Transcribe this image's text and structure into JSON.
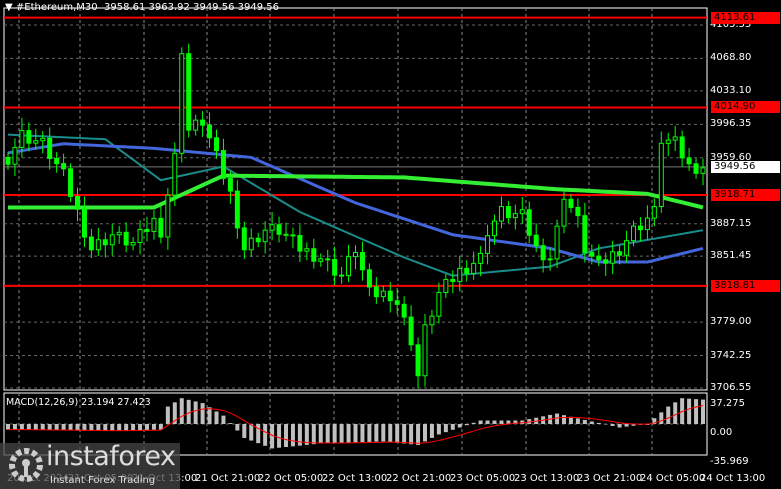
{
  "header": {
    "symbol": "#Ethereum,M30",
    "open": "3958.61",
    "high": "3963.92",
    "low": "3949.56",
    "close": "3949.56"
  },
  "price_axis": [
    "4105.55",
    "4068.80",
    "4033.10",
    "3996.35",
    "3959.60",
    "3887.15",
    "3851.45",
    "3779.00",
    "3742.25",
    "3706.55"
  ],
  "levels": [
    {
      "label": "4113.61",
      "value": 4113.61
    },
    {
      "label": "4014.90",
      "value": 4014.9
    },
    {
      "label": "3918.71",
      "value": 3918.71
    },
    {
      "label": "3818.81",
      "value": 3818.81
    }
  ],
  "current_price": {
    "label": "3949.56",
    "value": 3949.56
  },
  "macd": {
    "title": "MACD(12,26,9) 23.194 27.423",
    "axis": [
      "37.275",
      "0.00",
      "-35.969"
    ],
    "hist_keypoints": [
      [
        0,
        -8
      ],
      [
        14,
        -10
      ],
      [
        22,
        -8
      ],
      [
        23,
        25
      ],
      [
        25,
        37
      ],
      [
        28,
        30
      ],
      [
        31,
        12
      ],
      [
        34,
        -20
      ],
      [
        38,
        -35
      ],
      [
        45,
        -28
      ],
      [
        54,
        -25
      ],
      [
        59,
        -30
      ],
      [
        62,
        -15
      ],
      [
        68,
        5
      ],
      [
        74,
        5
      ],
      [
        79,
        15
      ],
      [
        82,
        8
      ],
      [
        88,
        -5
      ],
      [
        92,
        0
      ],
      [
        95,
        25
      ],
      [
        97,
        37
      ],
      [
        100,
        35
      ]
    ]
  },
  "time_axis": [
    "20 Oct 2024",
    "21 Oct 05:00",
    "21 Oct 13:00",
    "21 Oct 21:00",
    "22 Oct 05:00",
    "22 Oct 13:00",
    "22 Oct 21:00",
    "23 Oct 05:00",
    "23 Oct 13:00",
    "23 Oct 21:00",
    "24 Oct 05:00",
    "24 Oct 13:00"
  ],
  "chart_data": {
    "type": "candlestick",
    "ylim": [
      3706.55,
      4113.61
    ],
    "close_keypoints": [
      [
        0,
        3960
      ],
      [
        2,
        3985
      ],
      [
        5,
        3975
      ],
      [
        8,
        3940
      ],
      [
        11,
        3880
      ],
      [
        12,
        3860
      ],
      [
        15,
        3875
      ],
      [
        18,
        3865
      ],
      [
        21,
        3890
      ],
      [
        22,
        3880
      ],
      [
        24,
        3960
      ],
      [
        25,
        4080
      ],
      [
        26,
        3990
      ],
      [
        28,
        4000
      ],
      [
        30,
        3960
      ],
      [
        32,
        3920
      ],
      [
        34,
        3860
      ],
      [
        37,
        3880
      ],
      [
        39,
        3880
      ],
      [
        42,
        3860
      ],
      [
        45,
        3850
      ],
      [
        48,
        3830
      ],
      [
        50,
        3860
      ],
      [
        52,
        3810
      ],
      [
        55,
        3810
      ],
      [
        56,
        3800
      ],
      [
        58,
        3760
      ],
      [
        59,
        3720
      ],
      [
        60,
        3770
      ],
      [
        62,
        3810
      ],
      [
        65,
        3835
      ],
      [
        68,
        3850
      ],
      [
        69,
        3880
      ],
      [
        71,
        3900
      ],
      [
        74,
        3895
      ],
      [
        76,
        3860
      ],
      [
        78,
        3850
      ],
      [
        79,
        3880
      ],
      [
        80,
        3920
      ],
      [
        82,
        3890
      ],
      [
        83,
        3860
      ],
      [
        85,
        3840
      ],
      [
        88,
        3860
      ],
      [
        90,
        3880
      ],
      [
        93,
        3900
      ],
      [
        94,
        3980
      ],
      [
        96,
        3975
      ],
      [
        98,
        3950
      ],
      [
        100,
        3950
      ]
    ],
    "ma_green": [
      [
        0,
        3905
      ],
      [
        21,
        3905
      ],
      [
        31,
        3940
      ],
      [
        57,
        3938
      ],
      [
        79,
        3925
      ],
      [
        92,
        3920
      ],
      [
        100,
        3905
      ]
    ],
    "ma_blue": [
      [
        0,
        3965
      ],
      [
        8,
        3975
      ],
      [
        21,
        3970
      ],
      [
        35,
        3960
      ],
      [
        50,
        3910
      ],
      [
        64,
        3875
      ],
      [
        78,
        3860
      ],
      [
        85,
        3845
      ],
      [
        92,
        3845
      ],
      [
        100,
        3860
      ]
    ],
    "ma_teal": [
      [
        0,
        3985
      ],
      [
        14,
        3980
      ],
      [
        22,
        3935
      ],
      [
        31,
        3950
      ],
      [
        42,
        3900
      ],
      [
        57,
        3850
      ],
      [
        64,
        3830
      ],
      [
        78,
        3840
      ],
      [
        85,
        3860
      ],
      [
        100,
        3880
      ]
    ]
  },
  "logo": {
    "name": "instaforex",
    "tagline": "Instant Forex Trading"
  },
  "colors": {
    "candle": "#00ff00",
    "level": "#ff0000",
    "ma_green": "#33ee33",
    "ma_blue": "#4466dd",
    "ma_teal": "#1a8c8c"
  }
}
